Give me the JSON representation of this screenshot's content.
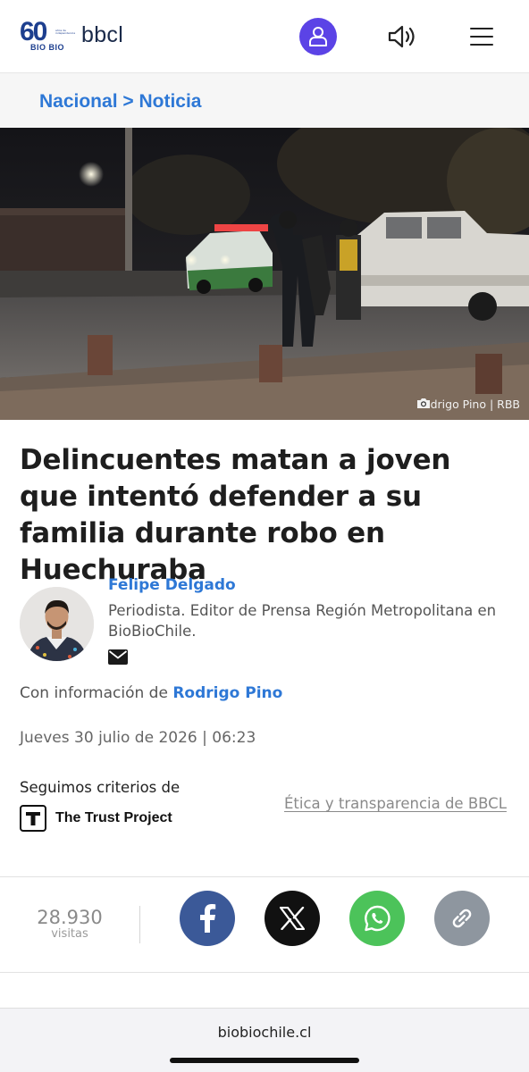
{
  "header": {
    "logo_number": "60",
    "logo_sub": "BIO BIO",
    "logo_tiny": "años de independencia",
    "logo_text": "bbcl",
    "user_icon": "user-icon",
    "audio_icon": "speaker-icon",
    "menu_icon": "hamburger-menu-icon",
    "accent_color": "#5b43e6"
  },
  "breadcrumb": {
    "section": "Nacional",
    "separator": " > ",
    "subsection": "Noticia"
  },
  "hero": {
    "caption": "Rodrigo Pino | RBB",
    "camera_icon": "camera-icon"
  },
  "article": {
    "headline": "Delincuentes matan a joven que intentó defender a su familia durante robo en Huechuraba",
    "author": {
      "name": "Felipe Delgado",
      "role": "Periodista. Editor de Prensa Región Metropolitana en BioBioChile."
    },
    "contributor_prefix": "Con información de ",
    "contributor_name": "Rodrigo Pino",
    "date": "Jueves 30 julio de 2026 | 06:23"
  },
  "trust": {
    "title": "Seguimos criterios de",
    "logo_text": "The Trust Project",
    "ethics_link": "Ética y transparencia de BBCL"
  },
  "share": {
    "visits_count": "28.930",
    "visits_label": "visitas",
    "buttons": [
      {
        "icon": "facebook-icon",
        "color": "#3b5998"
      },
      {
        "icon": "x-icon",
        "color": "#111111"
      },
      {
        "icon": "whatsapp-icon",
        "color": "#4cc35a"
      },
      {
        "icon": "link-icon",
        "color": "#8e969f"
      }
    ]
  },
  "browser": {
    "url": "biobiochile.cl"
  }
}
